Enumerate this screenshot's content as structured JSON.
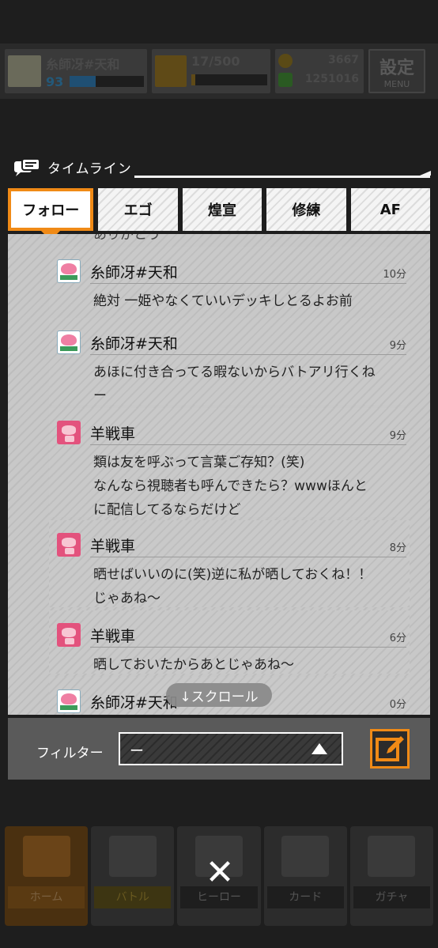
{
  "status": {
    "player_name": "糸師冴#天和",
    "level": "93",
    "level_progress": 0.35,
    "rank_value": "17/500",
    "rank_progress": 0.05,
    "coins": "3667",
    "gems": "1251016",
    "menu_top": "設定",
    "menu_bottom": "MENU"
  },
  "timeline": {
    "title": "タイムライン",
    "tabs": [
      "フォロー",
      "エゴ",
      "煌宣",
      "修練",
      "AF"
    ],
    "active_tab": 0,
    "cut_text": "ありがとう",
    "posts": [
      {
        "name": "糸師冴#天和",
        "time": "10分",
        "avatar": "peach",
        "lines": [
          "絶対 一姫やなくていいデッキしとるよお前"
        ]
      },
      {
        "name": "糸師冴#天和",
        "time": "9分",
        "avatar": "peach",
        "lines": [
          "あほに付き合ってる暇ないからバトアリ行くね",
          "ー"
        ]
      },
      {
        "name": "羊戦車",
        "time": "9分",
        "avatar": "sheep",
        "lines": [
          "類は友を呼ぶって言葉ご存知？(笑)",
          "なんなら視聴者も呼んできたら？wwwほんと",
          "に配信してるならだけど"
        ]
      },
      {
        "name": "羊戦車",
        "time": "8分",
        "avatar": "sheep",
        "lines": [
          "晒せばいいのに(笑)逆に私が晒しておくね！！",
          "じゃあね～"
        ]
      },
      {
        "name": "羊戦車",
        "time": "6分",
        "avatar": "sheep",
        "lines": [
          "晒しておいたからあとじゃあね～"
        ]
      },
      {
        "name": "糸師冴#天和",
        "time": "0分",
        "avatar": "peach",
        "lines": []
      }
    ],
    "scroll_hint": "↓スクロール"
  },
  "filter": {
    "label": "フィルター",
    "value": "ー"
  },
  "close_label": "✕",
  "nav": [
    "ホーム",
    "バトル",
    "ヒーロー",
    "カード",
    "ガチャ"
  ]
}
